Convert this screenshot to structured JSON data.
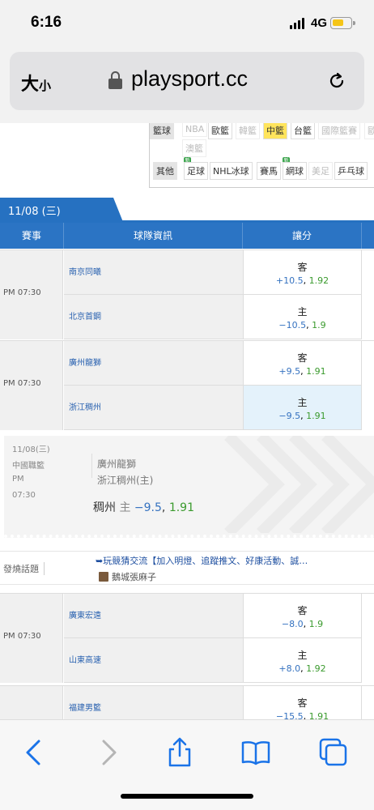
{
  "status": {
    "time": "6:16",
    "network": "4G"
  },
  "browser": {
    "text_size_label": "大",
    "text_size_small": "小",
    "domain": "playsport.cc"
  },
  "filters": {
    "row1": [
      "籃球",
      "NBA",
      "歐籃",
      "韓籃",
      "中籃",
      "台籃",
      "國際籃賽",
      "歐"
    ],
    "row2": [
      "澳籃"
    ],
    "row3_label": "其他",
    "row3": [
      "足球",
      "NHL冰球",
      "賽馬",
      "網球",
      "美足",
      "乒乓球"
    ],
    "highlighted": "中籃"
  },
  "date_tab": "11/08 (三)",
  "table_header": {
    "col_event": "賽事",
    "col_team": "球隊資訊",
    "col_spread": "讓分"
  },
  "games": [
    {
      "time": "PM 07:30",
      "away": {
        "team": "南京同曦",
        "side": "客",
        "handicap": "+10.5",
        "price": "1.92"
      },
      "home": {
        "team": "北京首鋼",
        "side": "主",
        "handicap": "−10.5",
        "price": "1.9"
      }
    },
    {
      "time": "PM 07:30",
      "away": {
        "team": "廣州龍獅",
        "side": "客",
        "handicap": "+9.5",
        "price": "1.91"
      },
      "home": {
        "team": "浙江稠州",
        "side": "主",
        "handicap": "−9.5",
        "price": "1.91"
      }
    },
    {
      "time": "PM 07:30",
      "away": {
        "team": "廣東宏遠",
        "side": "客",
        "handicap": "−8.0",
        "price": "1.9"
      },
      "home": {
        "team": "山東高速",
        "side": "主",
        "handicap": "+8.0",
        "price": "1.92"
      }
    },
    {
      "time": "",
      "away": {
        "team": "福建男籃",
        "side": "客",
        "handicap": "−15.5",
        "price": "1.91"
      }
    }
  ],
  "ticket": {
    "date": "11/08(三)",
    "league": "中國職籃",
    "ampm": "PM",
    "time": "07:30",
    "team1": "廣州龍獅",
    "team2": "浙江稠州(主)",
    "pick_team": "稠州",
    "pick_side": "主",
    "pick_handicap": "−9.5",
    "pick_price": "1.91"
  },
  "topic": {
    "label": "發燒話題",
    "title": "➥玩競猜交流【加入明燈、追蹤推文、好康活動、誠…",
    "user": "鵝城張麻子"
  },
  "icons": [
    "signal-icon",
    "battery-icon",
    "lock-icon",
    "reload-icon",
    "back-icon",
    "forward-icon",
    "share-icon",
    "bookmarks-icon",
    "tabs-icon"
  ]
}
